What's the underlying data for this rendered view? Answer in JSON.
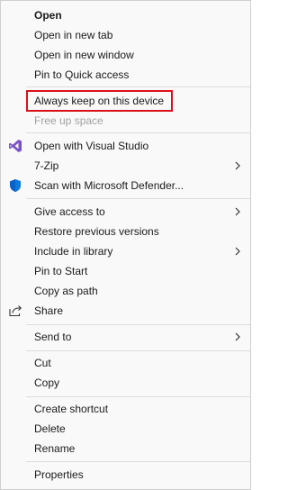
{
  "menu": {
    "items": [
      {
        "label": "Open",
        "bold": true
      },
      {
        "label": "Open in new tab"
      },
      {
        "label": "Open in new window"
      },
      {
        "label": "Pin to Quick access"
      },
      {
        "label": "Always keep on this device"
      },
      {
        "label": "Free up space",
        "disabled": true
      },
      {
        "label": "Open with Visual Studio",
        "icon": "visual-studio-icon"
      },
      {
        "label": "7-Zip",
        "submenu": true
      },
      {
        "label": "Scan with Microsoft Defender...",
        "icon": "defender-shield-icon"
      },
      {
        "label": "Give access to",
        "submenu": true
      },
      {
        "label": "Restore previous versions"
      },
      {
        "label": "Include in library",
        "submenu": true
      },
      {
        "label": "Pin to Start"
      },
      {
        "label": "Copy as path"
      },
      {
        "label": "Share",
        "icon": "share-icon"
      },
      {
        "label": "Send to",
        "submenu": true
      },
      {
        "label": "Cut"
      },
      {
        "label": "Copy"
      },
      {
        "label": "Create shortcut"
      },
      {
        "label": "Delete"
      },
      {
        "label": "Rename"
      },
      {
        "label": "Properties"
      }
    ]
  },
  "colors": {
    "highlight_border": "#d9121a",
    "visual_studio": "#7a52c7",
    "defender_blue": "#0a62c9"
  }
}
